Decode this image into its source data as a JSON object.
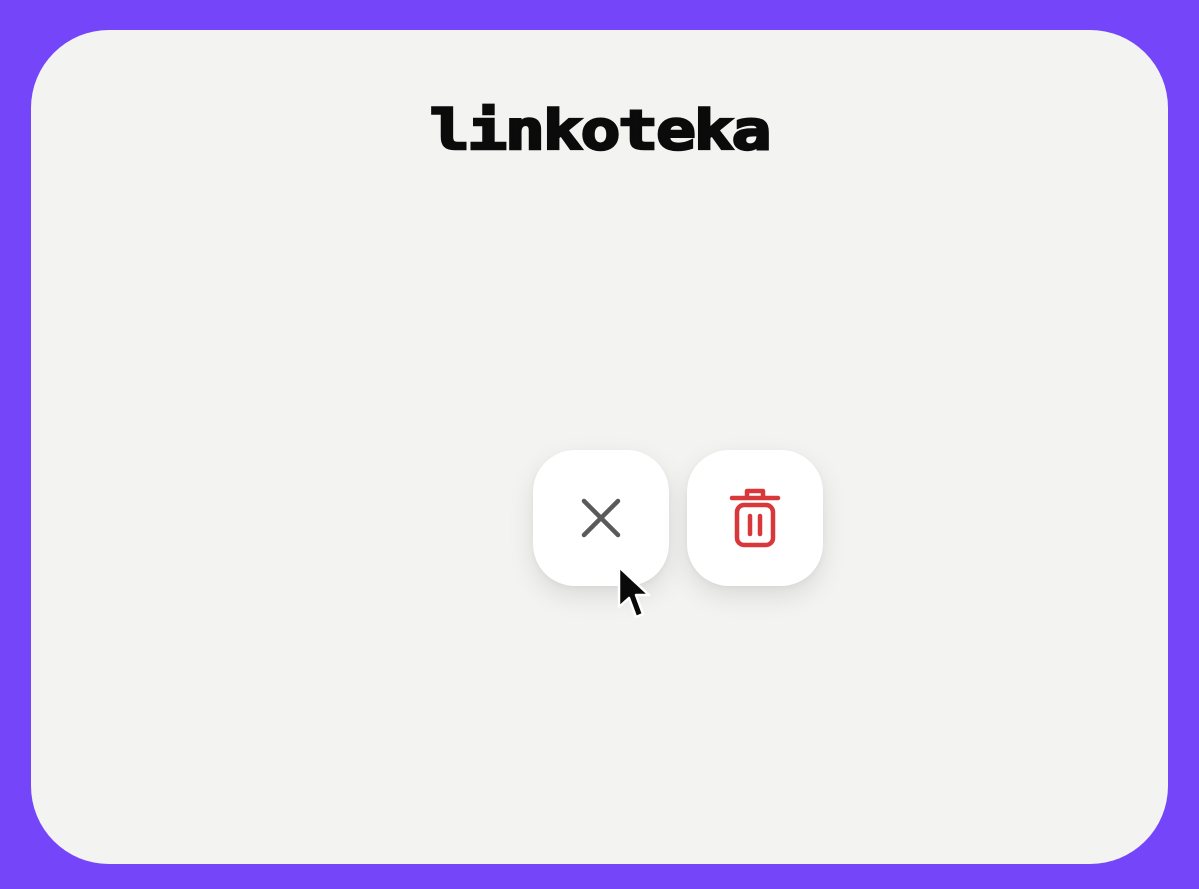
{
  "app": {
    "logo_text": "linkoteka"
  },
  "actions": [
    {
      "icon": "close-icon",
      "color": "#5a5a5a"
    },
    {
      "icon": "trash-icon",
      "color": "#d9383a"
    }
  ],
  "colors": {
    "frame": "#7546f9",
    "window": "#f3f3f1",
    "button": "#ffffff"
  }
}
